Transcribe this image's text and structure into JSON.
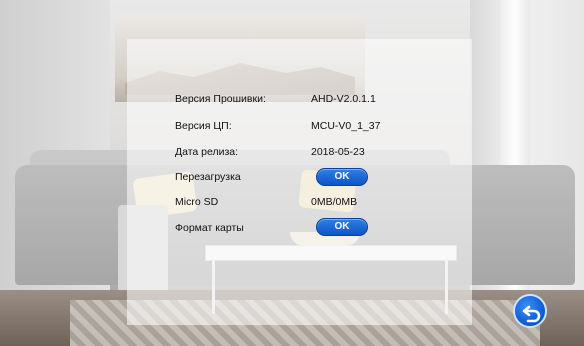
{
  "info": {
    "firmware_label": "Версия Прошивки:",
    "firmware_value": "AHD-V2.0.1.1",
    "cpu_label": "Версия ЦП:",
    "cpu_value": "MCU-V0_1_37",
    "release_label": "Дата релиза:",
    "release_value": "2018-05-23",
    "reboot_label": "Перезагрузка",
    "reboot_button": "OK",
    "sd_label": "Micro SD",
    "sd_value": "0MB/0MB",
    "format_label": "Формат карты",
    "format_button": "OK"
  },
  "icons": {
    "back": "back-arrow-icon"
  },
  "colors": {
    "button_blue": "#0d55c6",
    "text": "#111111"
  }
}
